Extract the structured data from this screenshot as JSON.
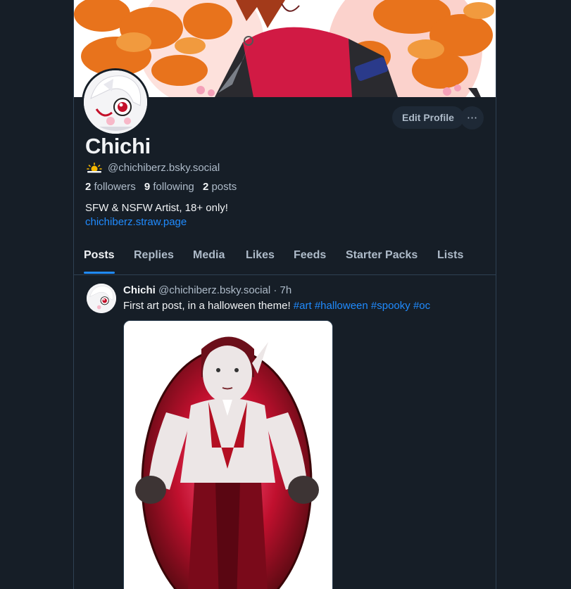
{
  "profile": {
    "display_name": "Chichi",
    "handle": "@chichiberz.bsky.social",
    "followers_count": "2",
    "followers_label": "followers",
    "following_count": "9",
    "following_label": "following",
    "posts_count": "2",
    "posts_label": "posts",
    "bio": "SFW & NSFW Artist, 18+ only!",
    "link": "chichiberz.straw.page"
  },
  "actions": {
    "edit_label": "Edit Profile",
    "more_label": "···"
  },
  "tabs": [
    "Posts",
    "Replies",
    "Media",
    "Likes",
    "Feeds",
    "Starter Packs",
    "Lists"
  ],
  "active_tab": "Posts",
  "post": {
    "author": "Chichi",
    "handle": "@chichiberz.bsky.social",
    "time": "· 7h",
    "text": "First art post, in a halloween theme!",
    "tags": [
      "#art",
      "#halloween",
      "#spooky",
      "#oc"
    ]
  },
  "colors": {
    "background": "#161e27",
    "accent": "#208bfe",
    "muted_text": "#aebbc9",
    "text": "#f1f3f5"
  },
  "icons": {
    "handle_badge": "sun-cloud-icon",
    "more": "ellipsis-icon"
  }
}
